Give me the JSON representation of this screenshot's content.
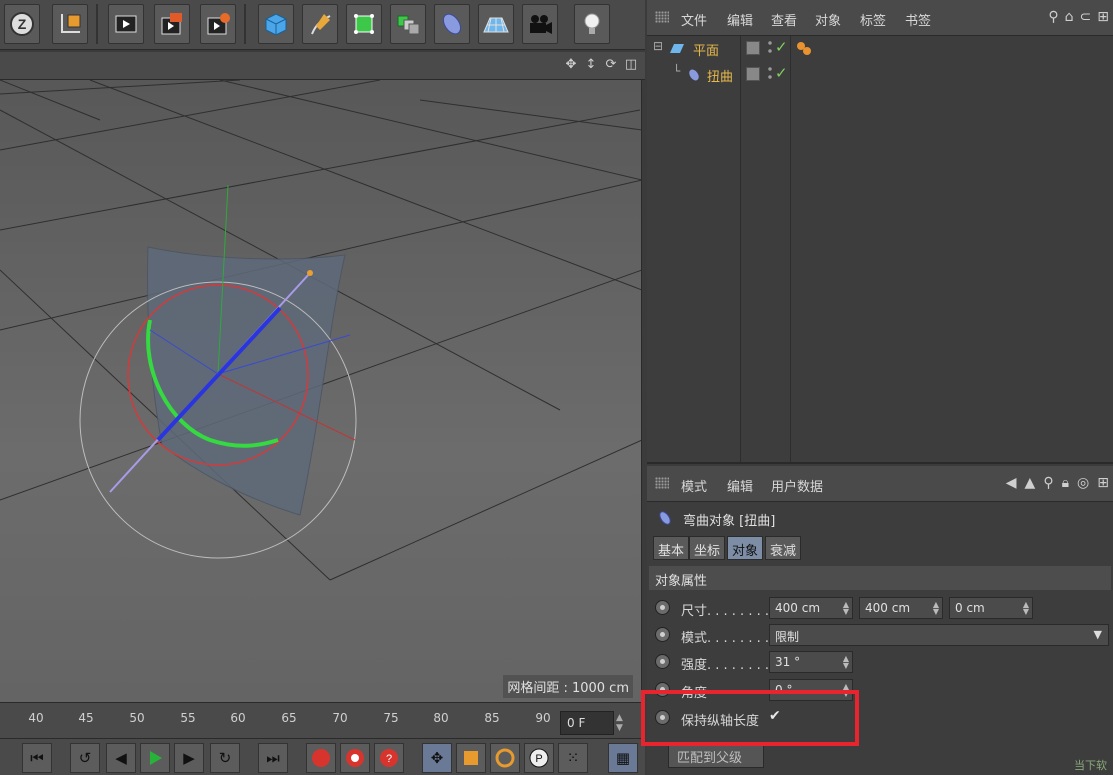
{
  "object_manager": {
    "menu": [
      "文件",
      "编辑",
      "查看",
      "对象",
      "标签",
      "书签"
    ],
    "objects": [
      {
        "name": "平面"
      },
      {
        "name": "扭曲"
      }
    ]
  },
  "attribute_manager": {
    "menu": [
      "模式",
      "编辑",
      "用户数据"
    ],
    "object_title": "弯曲对象 [扭曲]",
    "tabs": [
      "基本",
      "坐标",
      "对象",
      "衰减"
    ],
    "active_tab": "对象",
    "section": "对象属性",
    "props": {
      "size_label": "尺寸. . . . . . . .",
      "size_x": "400 cm",
      "size_y": "400 cm",
      "size_z": "0 cm",
      "mode_label": "模式. . . . . . . .",
      "mode_value": "限制",
      "strength_label": "强度. . . . . . . .",
      "strength_value": "31 °",
      "angle_label": "角度",
      "angle_value": "0 °",
      "keep_length_label": "保持纵轴长度",
      "keep_length_checked": "✔"
    },
    "match_button": "匹配到父级"
  },
  "viewport": {
    "grid_spacing": "网格间距 : 1000 cm"
  },
  "timeline": {
    "ticks": [
      "40",
      "45",
      "50",
      "55",
      "60",
      "65",
      "70",
      "75",
      "80",
      "85",
      "90"
    ],
    "current_frame": "0 F"
  },
  "colors": {
    "accent_tab": "#7d8da6",
    "object_name": "#e6b84a",
    "highlight": "#e8242e",
    "checkmark": "#7fd060"
  },
  "watermark": "当下软"
}
